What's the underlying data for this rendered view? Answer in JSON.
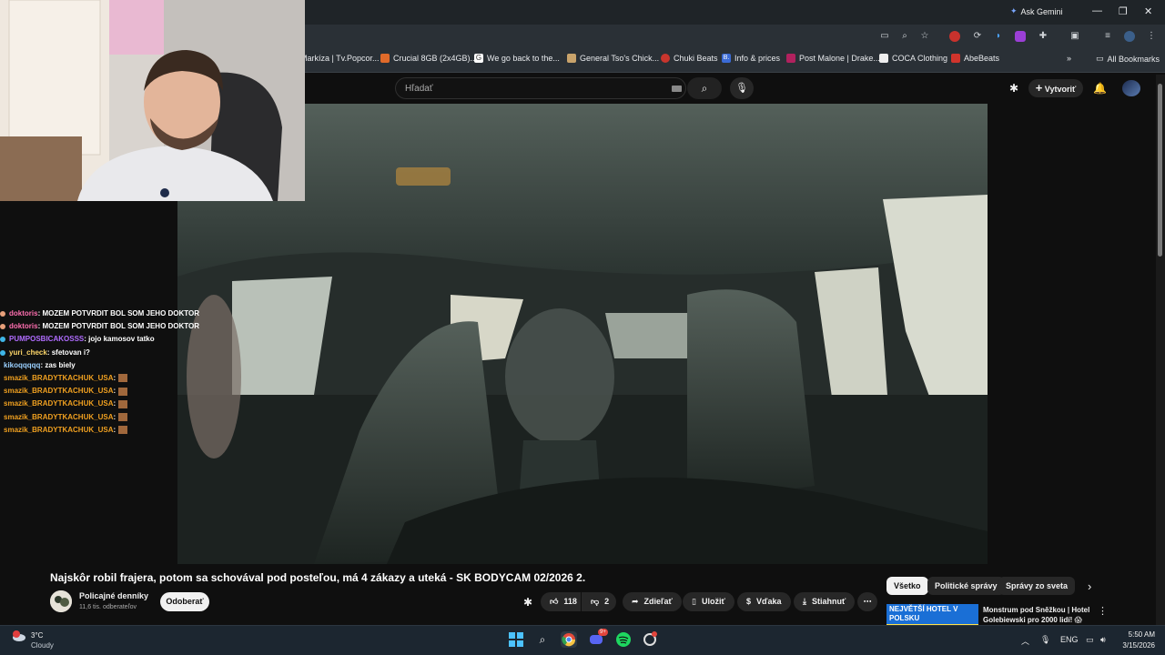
{
  "browser": {
    "ask_gemini": "Ask Gemini",
    "bookmarks": [
      {
        "label": "Markíza | Tv.Popcor...",
        "color": "#5c8ad8"
      },
      {
        "label": "Crucial 8GB (2x4GB)...",
        "color": "#e06a2a"
      },
      {
        "label": "We go back to the...",
        "color": "#ffffff"
      },
      {
        "label": "General Tso's Chick...",
        "color": "#c9a36b"
      },
      {
        "label": "Chuki Beats",
        "color": "#c8352d"
      },
      {
        "label": "Info & prices",
        "color": "#3b6bd6"
      },
      {
        "label": "Post Malone | Drake...",
        "color": "#b1215e"
      },
      {
        "label": "COCA Clothing",
        "color": "#eeeeee"
      },
      {
        "label": "AbeBeats",
        "color": "#d0342c"
      }
    ],
    "all_bookmarks": "All Bookmarks"
  },
  "youtube": {
    "search_placeholder": "Hľadať",
    "create_label": "Vytvoriť",
    "video_title": "Najskôr robil frajera, potom sa schovával pod posteľou, má 4 zákazy a uteká - SK BODYCAM 02/2026 2.",
    "channel_name": "Policajné denníky",
    "channel_subs": "11,6 tis. odberateľov",
    "subscribe_label": "Odoberať",
    "like_count": "118",
    "dislike_count": "2",
    "share_label": "Zdieľať",
    "save_label": "Uložiť",
    "thanks_label": "Vďaka",
    "download_label": "Stiahnuť",
    "chips": [
      "Všetko",
      "Politické správy",
      "Správy zo sveta"
    ],
    "rec_title": "Monstrum pod Sněžkou | Hotel Golebiewski pro 2000 lidí! 😱",
    "rec_thumb_text": "NEJVĚTŠÍ HOTEL V POLSKU"
  },
  "chat": [
    {
      "user": "doktoris",
      "msg": ": MOZEM POTVRDIT BOL SOM JEHO DOKTOR",
      "color": "#ff6fb0",
      "badge": "#e8a07a"
    },
    {
      "user": "doktoris",
      "msg": ": MOZEM POTVRDIT BOL SOM JEHO DOKTOR",
      "color": "#ff6fb0",
      "badge": "#e8a07a"
    },
    {
      "user": "PUMPOSBICAKOSSS",
      "msg": ": jojo kamosov tatko",
      "color": "#b06cff",
      "badge": "#3fb6e8"
    },
    {
      "user": "yuri_check",
      "msg": ": sfetovan i?",
      "color": "#ffd76a",
      "badge": "#3fb6e8"
    },
    {
      "user": "kikoqqqqq",
      "msg": ": zas biely",
      "color": "#9ad0ff",
      "badge": ""
    },
    {
      "user": "smazik_BRADYTKACHUK_USA",
      "msg": ":",
      "color": "#f0a020",
      "badge": ""
    },
    {
      "user": "smazik_BRADYTKACHUK_USA",
      "msg": ":",
      "color": "#f0a020",
      "badge": ""
    },
    {
      "user": "smazik_BRADYTKACHUK_USA",
      "msg": ":",
      "color": "#f0a020",
      "badge": ""
    },
    {
      "user": "smazik_BRADYTKACHUK_USA",
      "msg": ":",
      "color": "#f0a020",
      "badge": ""
    },
    {
      "user": "smazik_BRADYTKACHUK_USA",
      "msg": ":",
      "color": "#f0a020",
      "badge": ""
    }
  ],
  "taskbar": {
    "weather_temp": "3°C",
    "weather_desc": "Cloudy",
    "lang": "ENG",
    "time": "5:50 AM",
    "date": "3/15/2026",
    "discord_badge": "9+"
  }
}
